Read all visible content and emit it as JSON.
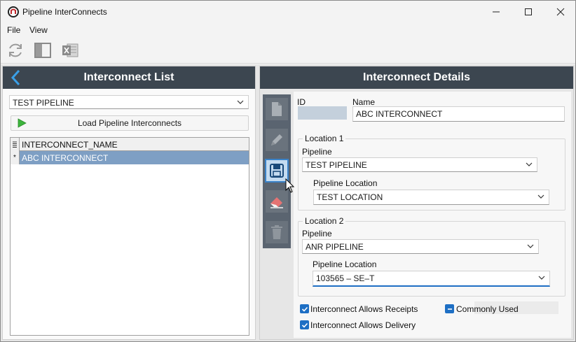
{
  "window": {
    "title": "Pipeline InterConnects"
  },
  "menu": [
    "File",
    "View"
  ],
  "toolbar": {
    "icons": [
      "refresh-icon",
      "panel-toggle-icon",
      "excel-export-icon"
    ]
  },
  "left_panel": {
    "title": "Interconnect List",
    "pipeline_select": "TEST PIPELINE",
    "load_button": "Load Pipeline Interconnects",
    "grid": {
      "column_header": "INTERCONNECT_NAME",
      "rows": [
        "ABC INTERCONNECT"
      ]
    }
  },
  "right_panel": {
    "title": "Interconnect Details",
    "side_buttons": [
      "new-document-icon",
      "edit-pencil-icon",
      "save-icon",
      "clear-eraser-icon",
      "delete-trash-icon"
    ],
    "id_label": "ID",
    "id_value": "",
    "name_label": "Name",
    "name_value": "ABC INTERCONNECT",
    "location1": {
      "title": "Location 1",
      "pipeline_label": "Pipeline",
      "pipeline_value": "TEST PIPELINE",
      "location_label": "Pipeline Location",
      "location_value": "TEST LOCATION"
    },
    "location2": {
      "title": "Location 2",
      "pipeline_label": "Pipeline",
      "pipeline_value": "ANR PIPELINE",
      "location_label": "Pipeline Location",
      "location_value": "103565 – SE–T"
    },
    "checks": {
      "allows_receipts": "Interconnect Allows Receipts",
      "allows_delivery": "Interconnect Allows Delivery",
      "commonly_used": "Commonly Used"
    }
  },
  "colors": {
    "header_bg": "#3c4650",
    "accent": "#1e6fc4",
    "selected_row": "#7e9fc4"
  }
}
